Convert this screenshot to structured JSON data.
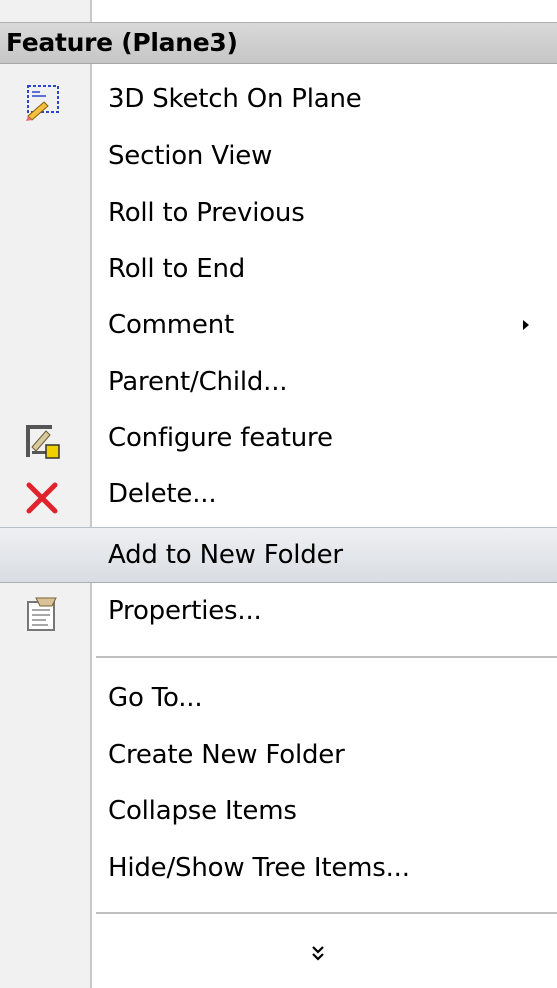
{
  "menu": {
    "header": "Feature (Plane3)",
    "items": [
      {
        "label": "3D Sketch On Plane",
        "icon": "sketch-on-plane-icon"
      },
      {
        "label": "Section View"
      },
      {
        "label": "Roll to Previous"
      },
      {
        "label": "Roll to End"
      },
      {
        "label": "Comment"
      },
      {
        "label": "Parent/Child..."
      },
      {
        "label": "Configure feature",
        "icon": "configure-feature-icon"
      },
      {
        "label": "Delete...",
        "icon": "delete-icon"
      },
      {
        "label": "Add to New Folder"
      },
      {
        "label": "Properties...",
        "icon": "properties-icon"
      },
      {
        "label": "Go To..."
      },
      {
        "label": "Create New Folder"
      },
      {
        "label": "Collapse Items"
      },
      {
        "label": "Hide/Show Tree Items..."
      }
    ],
    "expand_icon": "double-chevron-down-icon",
    "colors": {
      "delete_x": "#e0232c",
      "highlight": "#dde1e6",
      "gutter": "#f1f1f1"
    }
  }
}
